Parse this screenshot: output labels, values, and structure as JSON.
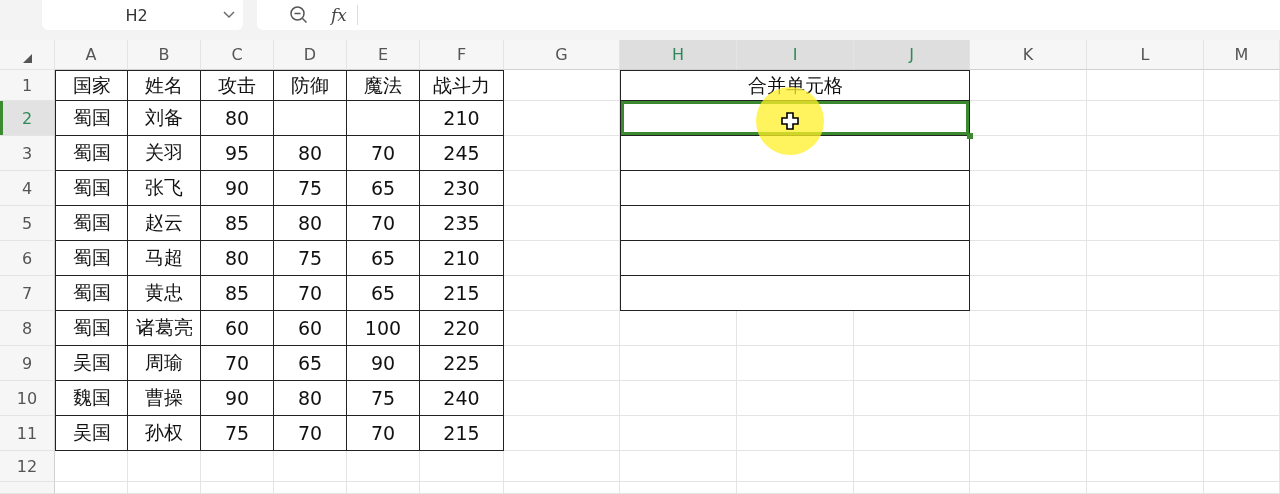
{
  "name_box": "H2",
  "formula_bar": {
    "function_label": "fx"
  },
  "columns": [
    {
      "label": "A",
      "selected": false
    },
    {
      "label": "B",
      "selected": false
    },
    {
      "label": "C",
      "selected": false
    },
    {
      "label": "D",
      "selected": false
    },
    {
      "label": "E",
      "selected": false
    },
    {
      "label": "F",
      "selected": false
    },
    {
      "label": "G",
      "selected": false
    },
    {
      "label": "H",
      "selected": true
    },
    {
      "label": "I",
      "selected": true
    },
    {
      "label": "J",
      "selected": true
    },
    {
      "label": "K",
      "selected": false
    },
    {
      "label": "L",
      "selected": false
    },
    {
      "label": "M",
      "selected": false
    }
  ],
  "rows": [
    {
      "label": "1",
      "selected": false
    },
    {
      "label": "2",
      "selected": true
    },
    {
      "label": "3",
      "selected": false
    },
    {
      "label": "4",
      "selected": false
    },
    {
      "label": "5",
      "selected": false
    },
    {
      "label": "6",
      "selected": false
    },
    {
      "label": "7",
      "selected": false
    },
    {
      "label": "8",
      "selected": false
    },
    {
      "label": "9",
      "selected": false
    },
    {
      "label": "10",
      "selected": false
    },
    {
      "label": "11",
      "selected": false
    },
    {
      "label": "12",
      "selected": false
    }
  ],
  "table": {
    "header": [
      "国家",
      "姓名",
      "攻击",
      "防御",
      "魔法",
      "战斗力"
    ],
    "rows": [
      [
        "蜀国",
        "刘备",
        "80",
        null,
        null,
        "210"
      ],
      [
        "蜀国",
        "关羽",
        "95",
        "80",
        "70",
        "245"
      ],
      [
        "蜀国",
        "张飞",
        "90",
        "75",
        "65",
        "230"
      ],
      [
        "蜀国",
        "赵云",
        "85",
        "80",
        "70",
        "235"
      ],
      [
        "蜀国",
        "马超",
        "80",
        "75",
        "65",
        "210"
      ],
      [
        "蜀国",
        "黄忠",
        "85",
        "70",
        "65",
        "215"
      ],
      [
        "蜀国",
        "诸葛亮",
        "60",
        "60",
        "100",
        "220"
      ],
      [
        "吴国",
        "周瑜",
        "70",
        "65",
        "90",
        "225"
      ],
      [
        "魏国",
        "曹操",
        "90",
        "80",
        "75",
        "240"
      ],
      [
        "吴国",
        "孙权",
        "75",
        "70",
        "70",
        "215"
      ]
    ]
  },
  "merged_block": [
    {
      "text": "合并单元格",
      "selected": false
    },
    {
      "selected": true
    },
    {
      "selected": false
    },
    {
      "selected": false
    },
    {
      "selected": false
    },
    {
      "selected": false
    },
    {
      "selected": false
    }
  ]
}
